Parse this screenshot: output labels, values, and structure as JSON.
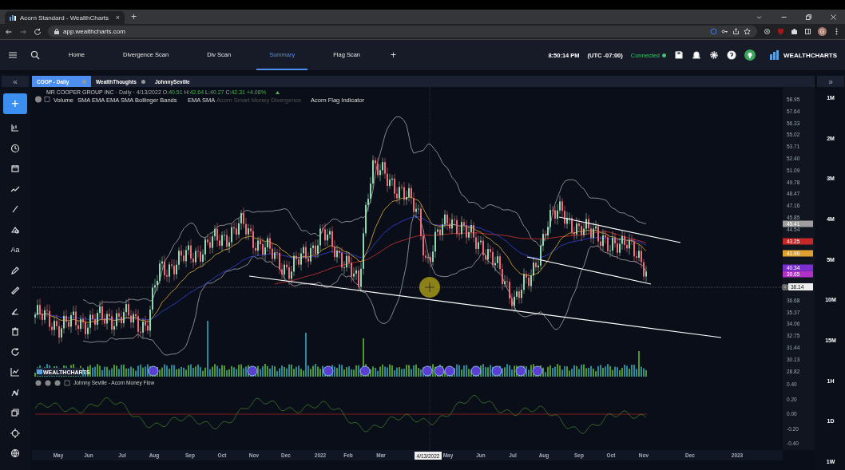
{
  "browser": {
    "tab_title": "Acorn Standard - WealthCharts",
    "tab_close": "×",
    "new_tab": "+",
    "url": "app.wealthcharts.com",
    "profile_initial": "G"
  },
  "nav": {
    "tabs": [
      {
        "label": "Home",
        "selected": false
      },
      {
        "label": "Divergence Scan",
        "selected": false
      },
      {
        "label": "Div Scan",
        "selected": false
      },
      {
        "label": "Summary",
        "selected": true
      },
      {
        "label": "Flag Scan",
        "selected": false
      }
    ],
    "add_tab": "+",
    "time": "8:50:14 PM",
    "timezone": "(UTC -07:00)",
    "status": "Connected",
    "connected": true,
    "logo": "WEALTHCHARTS"
  },
  "left_panel": {
    "collapse": "«",
    "add": "+",
    "text_tool": "Aa"
  },
  "right_panel": {
    "expand": "»",
    "timeframes": [
      "1M",
      "2M",
      "3M",
      "4M",
      "5M",
      "10M",
      "15M",
      "1H",
      "1D",
      "1W"
    ]
  },
  "chart_tabs": [
    {
      "label": "COOP - Daily",
      "selected": true
    },
    {
      "label": "WealthThoughts",
      "selected": false
    },
    {
      "label": "JohnnySeville",
      "selected": false
    }
  ],
  "legend": {
    "company": "MR COOPER GROUP INC",
    "info": " · Daily · 4/13/2022 ",
    "ohlc": [
      {
        "label": "O:",
        "value": "40.51"
      },
      {
        "label": "H:",
        "value": "42.64"
      },
      {
        "label": "L:",
        "value": "40.27"
      },
      {
        "label": "C:",
        "value": "42.31"
      }
    ],
    "change": "+4.08%"
  },
  "indicators": [
    {
      "label": "Volume",
      "disabled": false
    },
    {
      "label": "SMA",
      "disabled": false
    },
    {
      "label": "EMA",
      "disabled": false
    },
    {
      "label": "EMA",
      "disabled": false
    },
    {
      "label": "SMA",
      "disabled": false
    },
    {
      "label": "Bollinger Bands",
      "disabled": false
    },
    {
      "label": "EMA",
      "disabled": false
    },
    {
      "label": "SMA",
      "disabled": false
    },
    {
      "label": "Acorn Smart Money Divergence",
      "disabled": true
    },
    {
      "label": "Acorn Flag Indicator",
      "disabled": false
    }
  ],
  "price_axis": [
    "58.95",
    "57.64",
    "56.33",
    "55.02",
    "53.71",
    "52.40",
    "51.09",
    "49.78",
    "48.47",
    "47.16",
    "45.85",
    "44.54",
    "36.68",
    "35.37",
    "34.06",
    "32.75",
    "31.44",
    "30.13",
    "28.82"
  ],
  "price_tags": [
    {
      "label": "45.41",
      "color": "#9e9e9e"
    },
    {
      "label": "43.25",
      "color": "#c62828"
    },
    {
      "label": "41.90",
      "color": "#e0a030"
    },
    {
      "label": "40.34",
      "color": "#7b2fd0"
    },
    {
      "label": "39.65",
      "color": "#b030c8"
    }
  ],
  "crosshair": {
    "price": "38.14",
    "date": "4/13/2022"
  },
  "chart_logo": "WEALTHCHARTS",
  "oscillator": {
    "title": "Johnny Seville - Acorn Money Flow",
    "axis": [
      "0.40",
      "0.20",
      "0.00",
      "-0.20",
      "-0.40"
    ]
  },
  "time_axis": [
    "May",
    "Jun",
    "Jul",
    "Aug",
    "Sep",
    "Oct",
    "Nov",
    "Dec",
    "2022",
    "Feb",
    "Mar",
    "May",
    "Jun",
    "Jul",
    "Aug",
    "Sep",
    "Oct",
    "Nov",
    "Dec",
    "2023"
  ]
}
